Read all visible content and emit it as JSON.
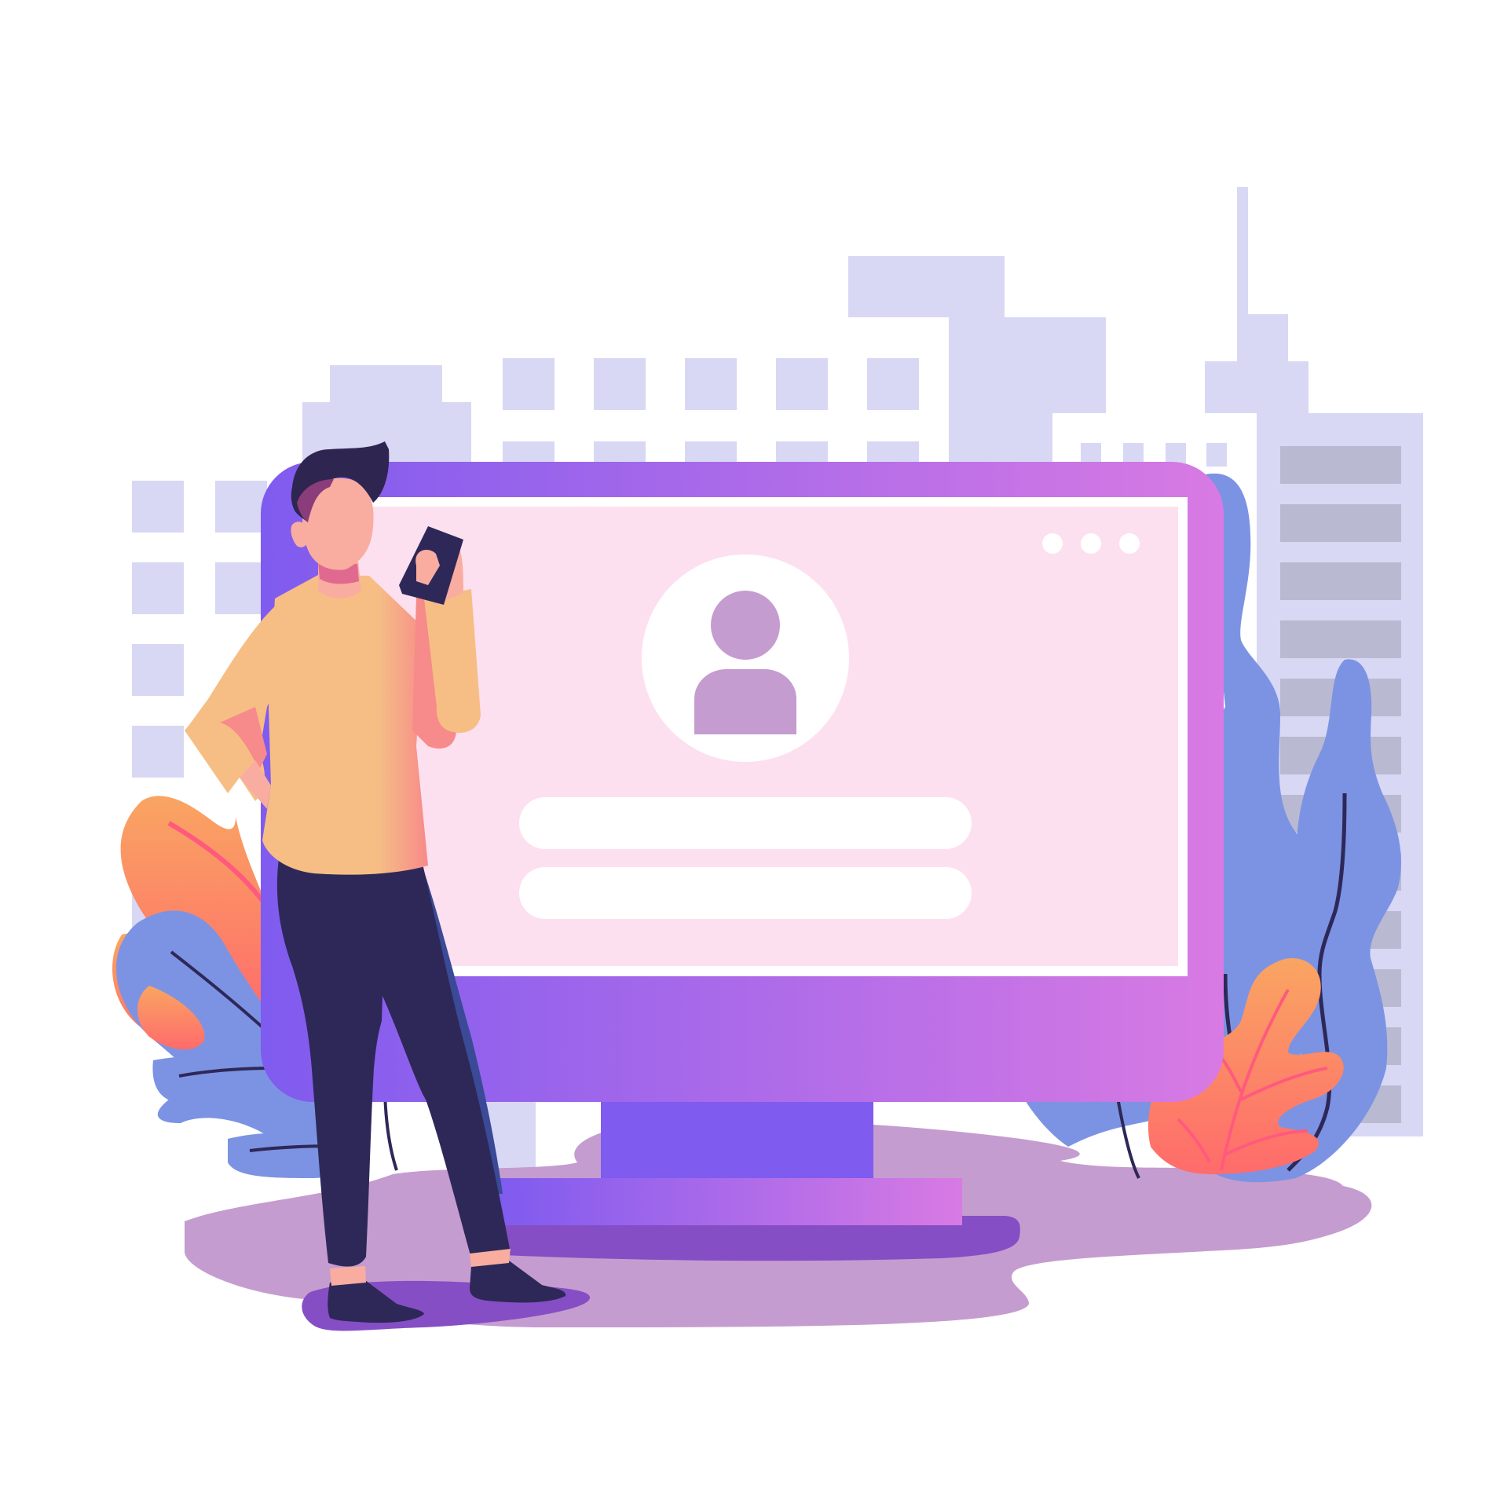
{
  "illustration": {
    "scene": "user-profile-login-illustration",
    "colors": {
      "background": "#ffffff",
      "buildings": "#d8d8f5",
      "building_windows": "#b9b9d1",
      "monitor_gradient_start": "#7f5bef",
      "monitor_gradient_end": "#d87ae3",
      "screen": "#fde0ef",
      "avatar": "#c59ccf",
      "ground": "#c59ccf",
      "ground_dark": "#864ec4",
      "leaf_blue": "#7c93e3",
      "leaf_orange": "#f9a562",
      "leaf_red": "#ff6b6b",
      "shirt": "#f6be85",
      "pants": "#2e2858",
      "skin": "#f9ada0",
      "hair": "#2e2650"
    },
    "icons": [
      "window-dots-icon",
      "user-avatar-icon",
      "smartphone-icon"
    ]
  }
}
